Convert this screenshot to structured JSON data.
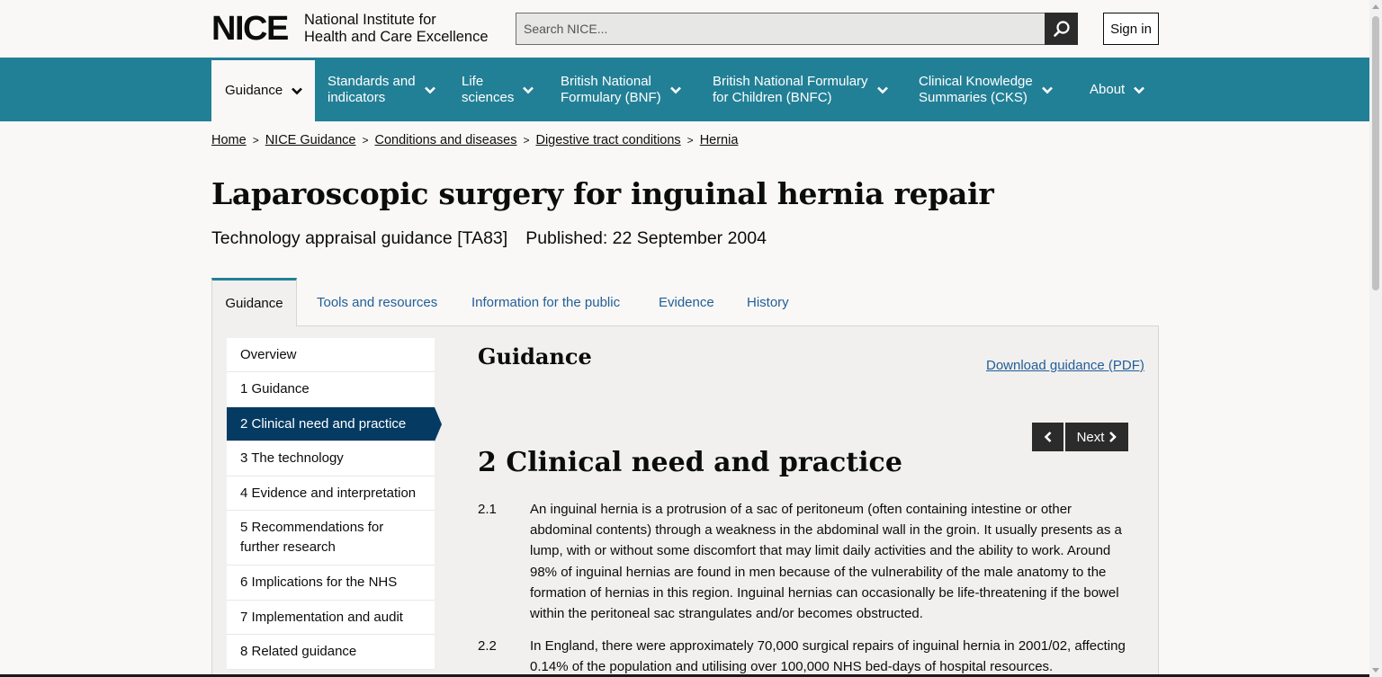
{
  "header": {
    "logo_mark": "NICE",
    "logo_line1": "National Institute for",
    "logo_line2": "Health and Care Excellence",
    "search_placeholder": "Search NICE...",
    "sign_in": "Sign in"
  },
  "nav": {
    "items": [
      {
        "label": "Guidance",
        "icon": "chevron-down-icon"
      },
      {
        "label": "Standards and\nindicators",
        "icon": "chevron-down-icon"
      },
      {
        "label": "Life\nsciences",
        "icon": "chevron-down-icon"
      },
      {
        "label": "British National\nFormulary (BNF)",
        "icon": "chevron-down-icon"
      },
      {
        "label": "British National Formulary\nfor Children (BNFC)",
        "icon": "chevron-down-icon"
      },
      {
        "label": "Clinical Knowledge\nSummaries (CKS)",
        "icon": "chevron-down-icon"
      },
      {
        "label": "About",
        "icon": "chevron-down-icon"
      }
    ]
  },
  "breadcrumb": [
    "Home",
    "NICE Guidance",
    "Conditions and diseases",
    "Digestive tract conditions",
    "Hernia"
  ],
  "page": {
    "title": "Laparoscopic surgery for inguinal hernia repair",
    "type": "Technology appraisal guidance [TA83]",
    "published": "Published: 22 September 2004"
  },
  "tabs": [
    "Guidance",
    "Tools and resources",
    "Information for the public",
    "Evidence",
    "History"
  ],
  "sidenav": [
    "Overview",
    "1 Guidance",
    "2 Clinical need and practice",
    "3 The technology",
    "4 Evidence and interpretation",
    "5 Recommendations for further research",
    "6 Implications for the NHS",
    "7 Implementation and audit",
    "8 Related guidance"
  ],
  "content": {
    "heading": "Guidance",
    "download": "Download guidance (PDF)",
    "next": "Next",
    "section_title": "2 Clinical need and practice",
    "paragraphs": [
      {
        "num": "2.1",
        "text": "An inguinal hernia is a protrusion of a sac of peritoneum (often containing intestine or other abdominal contents) through a weakness in the abdominal wall in the groin. It usually presents as a lump, with or without some discomfort that may limit daily activities and the ability to work. Around 98% of inguinal hernias are found in men because of the vulnerability of the male anatomy to the formation of hernias in this region. Inguinal hernias can occasionally be life-threatening if the bowel within the peritoneal sac strangulates and/or becomes obstructed."
      },
      {
        "num": "2.2",
        "text": "In England, there were approximately 70,000 surgical repairs of inguinal hernia in 2001/02, affecting 0.14% of the population and utilising over 100,000 NHS bed-days of hospital resources."
      }
    ]
  },
  "colors": {
    "nav_bg": "#228096",
    "active_side": "#053b63",
    "link": "#225e99"
  }
}
